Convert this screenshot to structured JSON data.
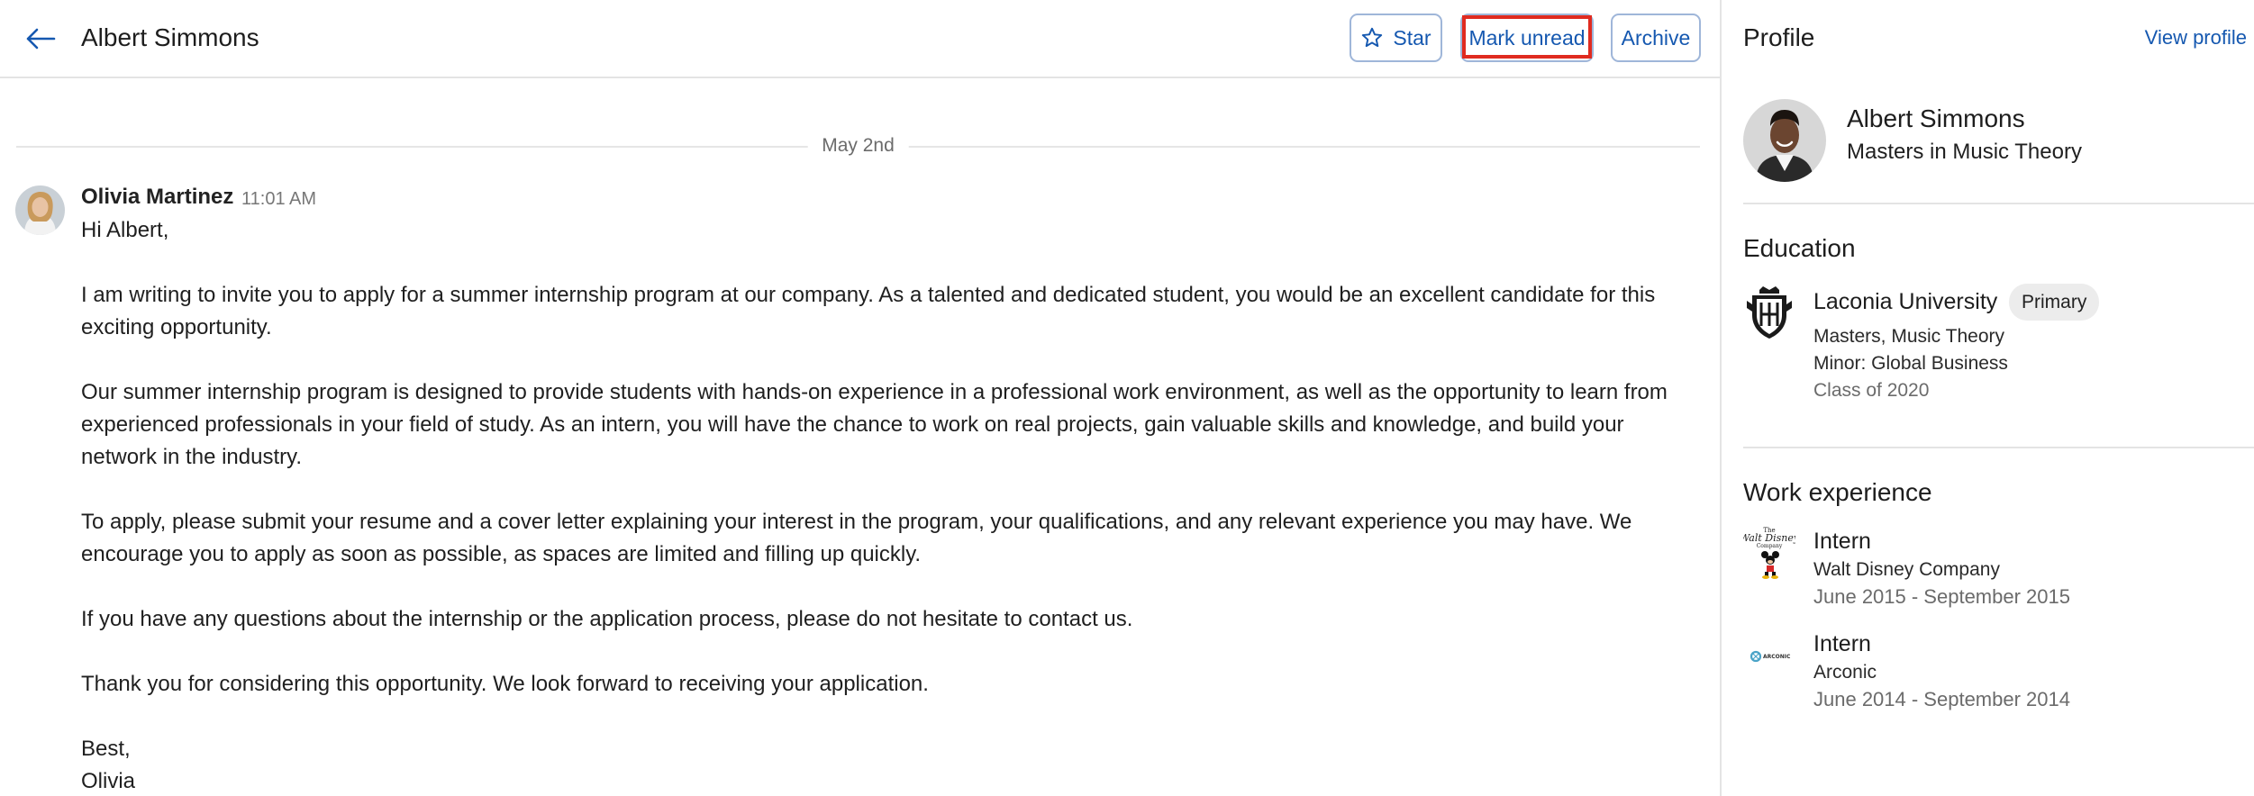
{
  "header": {
    "title": "Albert Simmons",
    "star_label": "Star",
    "mark_unread_label": "Mark unread",
    "archive_label": "Archive"
  },
  "thread": {
    "date": "May 2nd",
    "message": {
      "sender": "Olivia Martinez",
      "time": "11:01 AM",
      "paragraphs": [
        "Hi Albert,",
        "I am writing to invite you to apply for a summer internship program at our company. As a talented and dedicated student, you would be an excellent candidate for this exciting opportunity.",
        "Our summer internship program is designed to provide students with hands-on experience in a professional work environment, as well as the opportunity to learn from experienced professionals in your field of study. As an intern, you will have the chance to work on real projects, gain valuable skills and knowledge, and build your network in the industry.",
        "To apply, please submit your resume and a cover letter explaining your interest in the program, your qualifications, and any relevant experience you may have. We encourage you to apply as soon as possible, as spaces are limited and filling up quickly.",
        "If you have any questions about the internship or the application process, please do not hesitate to contact us.",
        "Thank you for considering this opportunity. We look forward to receiving your application.",
        "Best,",
        "Olivia"
      ]
    }
  },
  "profile": {
    "title": "Profile",
    "view_profile_label": "View profile",
    "name": "Albert Simmons",
    "degree": "Masters in Music Theory",
    "education": {
      "title": "Education",
      "school": "Laconia University",
      "badge": "Primary",
      "program": "Masters, Music Theory",
      "minor": "Minor: Global Business",
      "class_of": "Class of 2020"
    },
    "work": {
      "title": "Work experience",
      "jobs": [
        {
          "title": "Intern",
          "company": "Walt Disney Company",
          "dates": "June 2015 - September 2015",
          "logo_icon": "disney-logo-icon"
        },
        {
          "title": "Intern",
          "company": "Arconic",
          "dates": "June 2014 - September 2014",
          "logo_icon": "arconic-logo-icon"
        }
      ]
    }
  },
  "colors": {
    "accent": "#1558b0",
    "highlight": "#e02b20",
    "divider": "#e4e4e4"
  }
}
